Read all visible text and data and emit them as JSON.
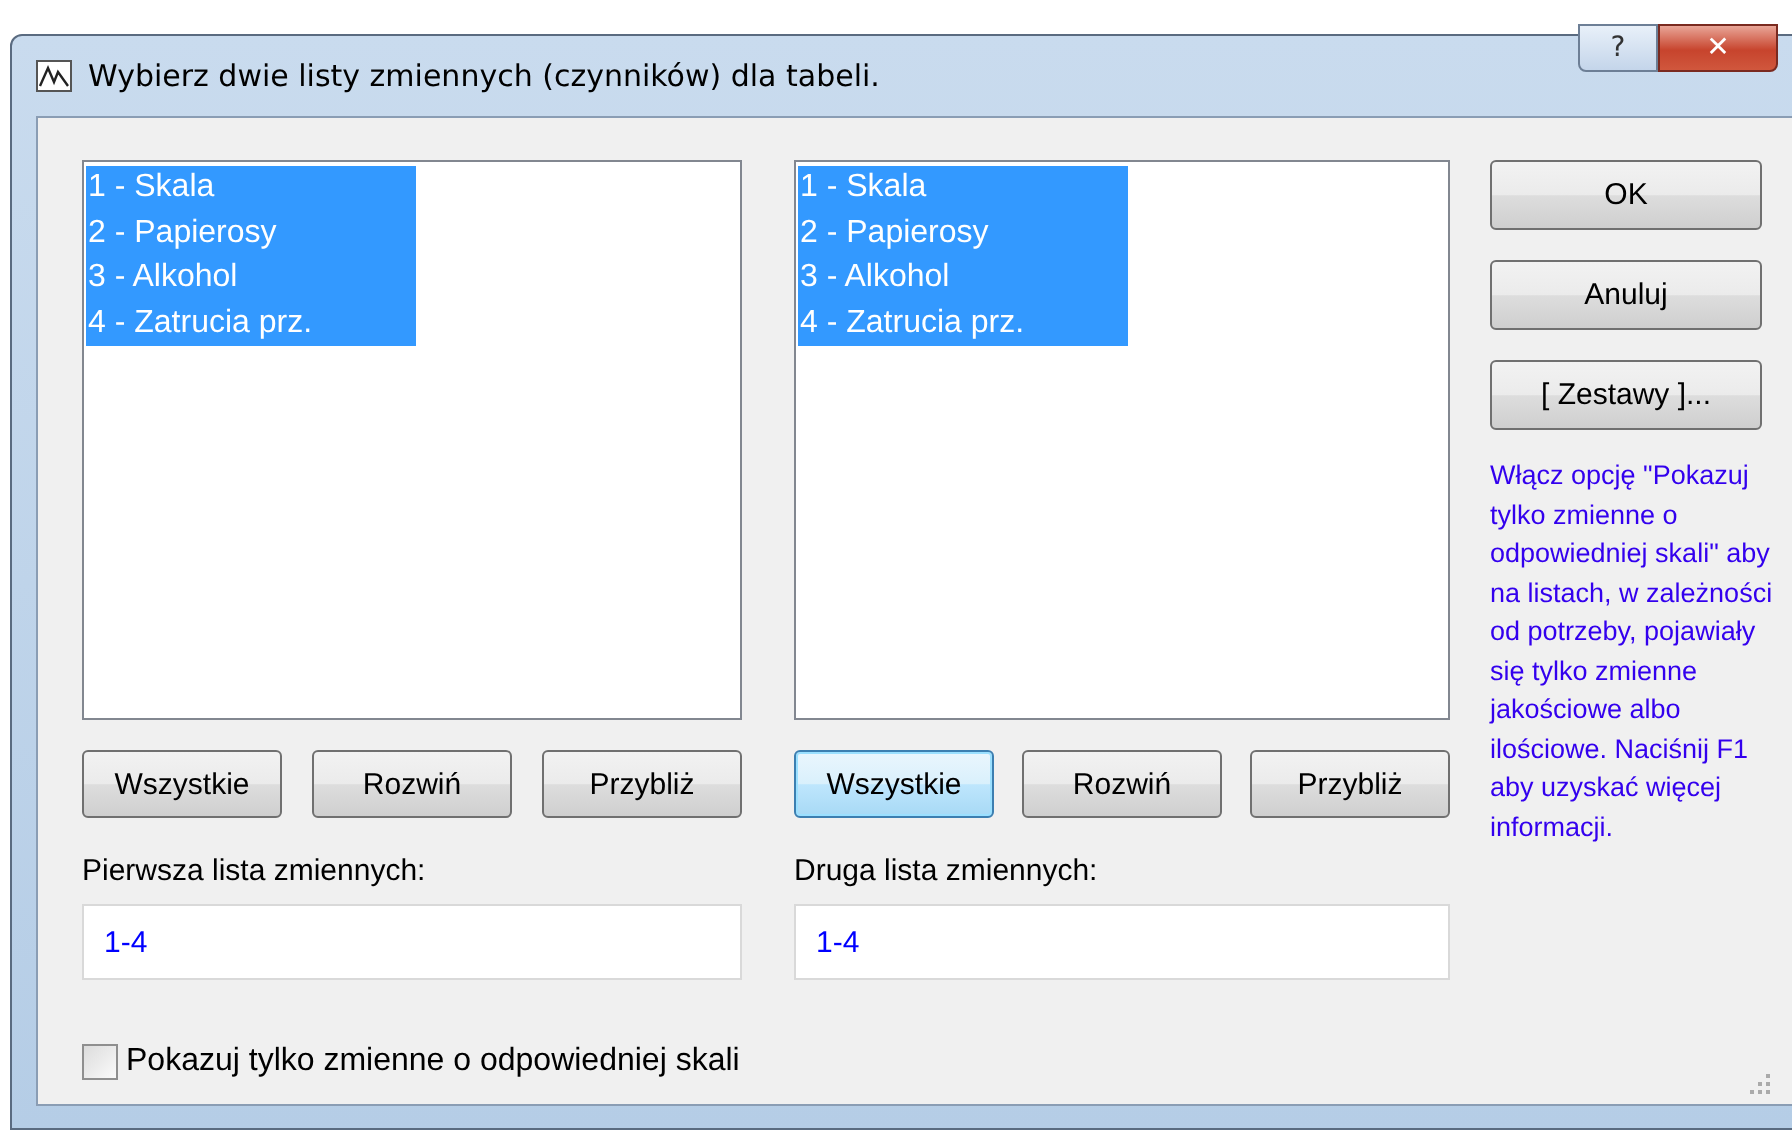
{
  "window": {
    "title": "Wybierz dwie listy zmiennych (czynników) dla tabeli.",
    "help_button": "?",
    "close_button": "✕"
  },
  "lists": [
    {
      "items": [
        {
          "label": "1 - Skala",
          "selected": true
        },
        {
          "label": "2 - Papierosy",
          "selected": true
        },
        {
          "label": "3 - Alkohol",
          "selected": true
        },
        {
          "label": "4 - Zatrucia prz.",
          "selected": true
        }
      ],
      "buttons": [
        {
          "label": "Wszystkie",
          "focused": false
        },
        {
          "label": "Rozwiń",
          "focused": false
        },
        {
          "label": "Przybliż",
          "focused": false
        }
      ],
      "field_label": "Pierwsza lista zmiennych:",
      "field_value": "1-4"
    },
    {
      "items": [
        {
          "label": "1 - Skala",
          "selected": true
        },
        {
          "label": "2 - Papierosy",
          "selected": true
        },
        {
          "label": "3 - Alkohol",
          "selected": true
        },
        {
          "label": "4 - Zatrucia prz.",
          "selected": true
        }
      ],
      "buttons": [
        {
          "label": "Wszystkie",
          "focused": true
        },
        {
          "label": "Rozwiń",
          "focused": false
        },
        {
          "label": "Przybliż",
          "focused": false
        }
      ],
      "field_label": "Druga lista zmiennych:",
      "field_value": "1-4"
    }
  ],
  "side_buttons": [
    "OK",
    "Anuluj",
    "[ Zestawy ]..."
  ],
  "hint": "Włącz opcję \"Pokazuj tylko zmienne o odpowiedniej skali\" aby na listach, w zależności od potrzeby, pojawiały się tylko zmienne jakościowe albo ilościowe. Naciśnij F1 aby uzyskać więcej informacji.",
  "checkbox": {
    "label": "Pokazuj tylko zmienne o odpowiedniej skali",
    "checked": false
  }
}
